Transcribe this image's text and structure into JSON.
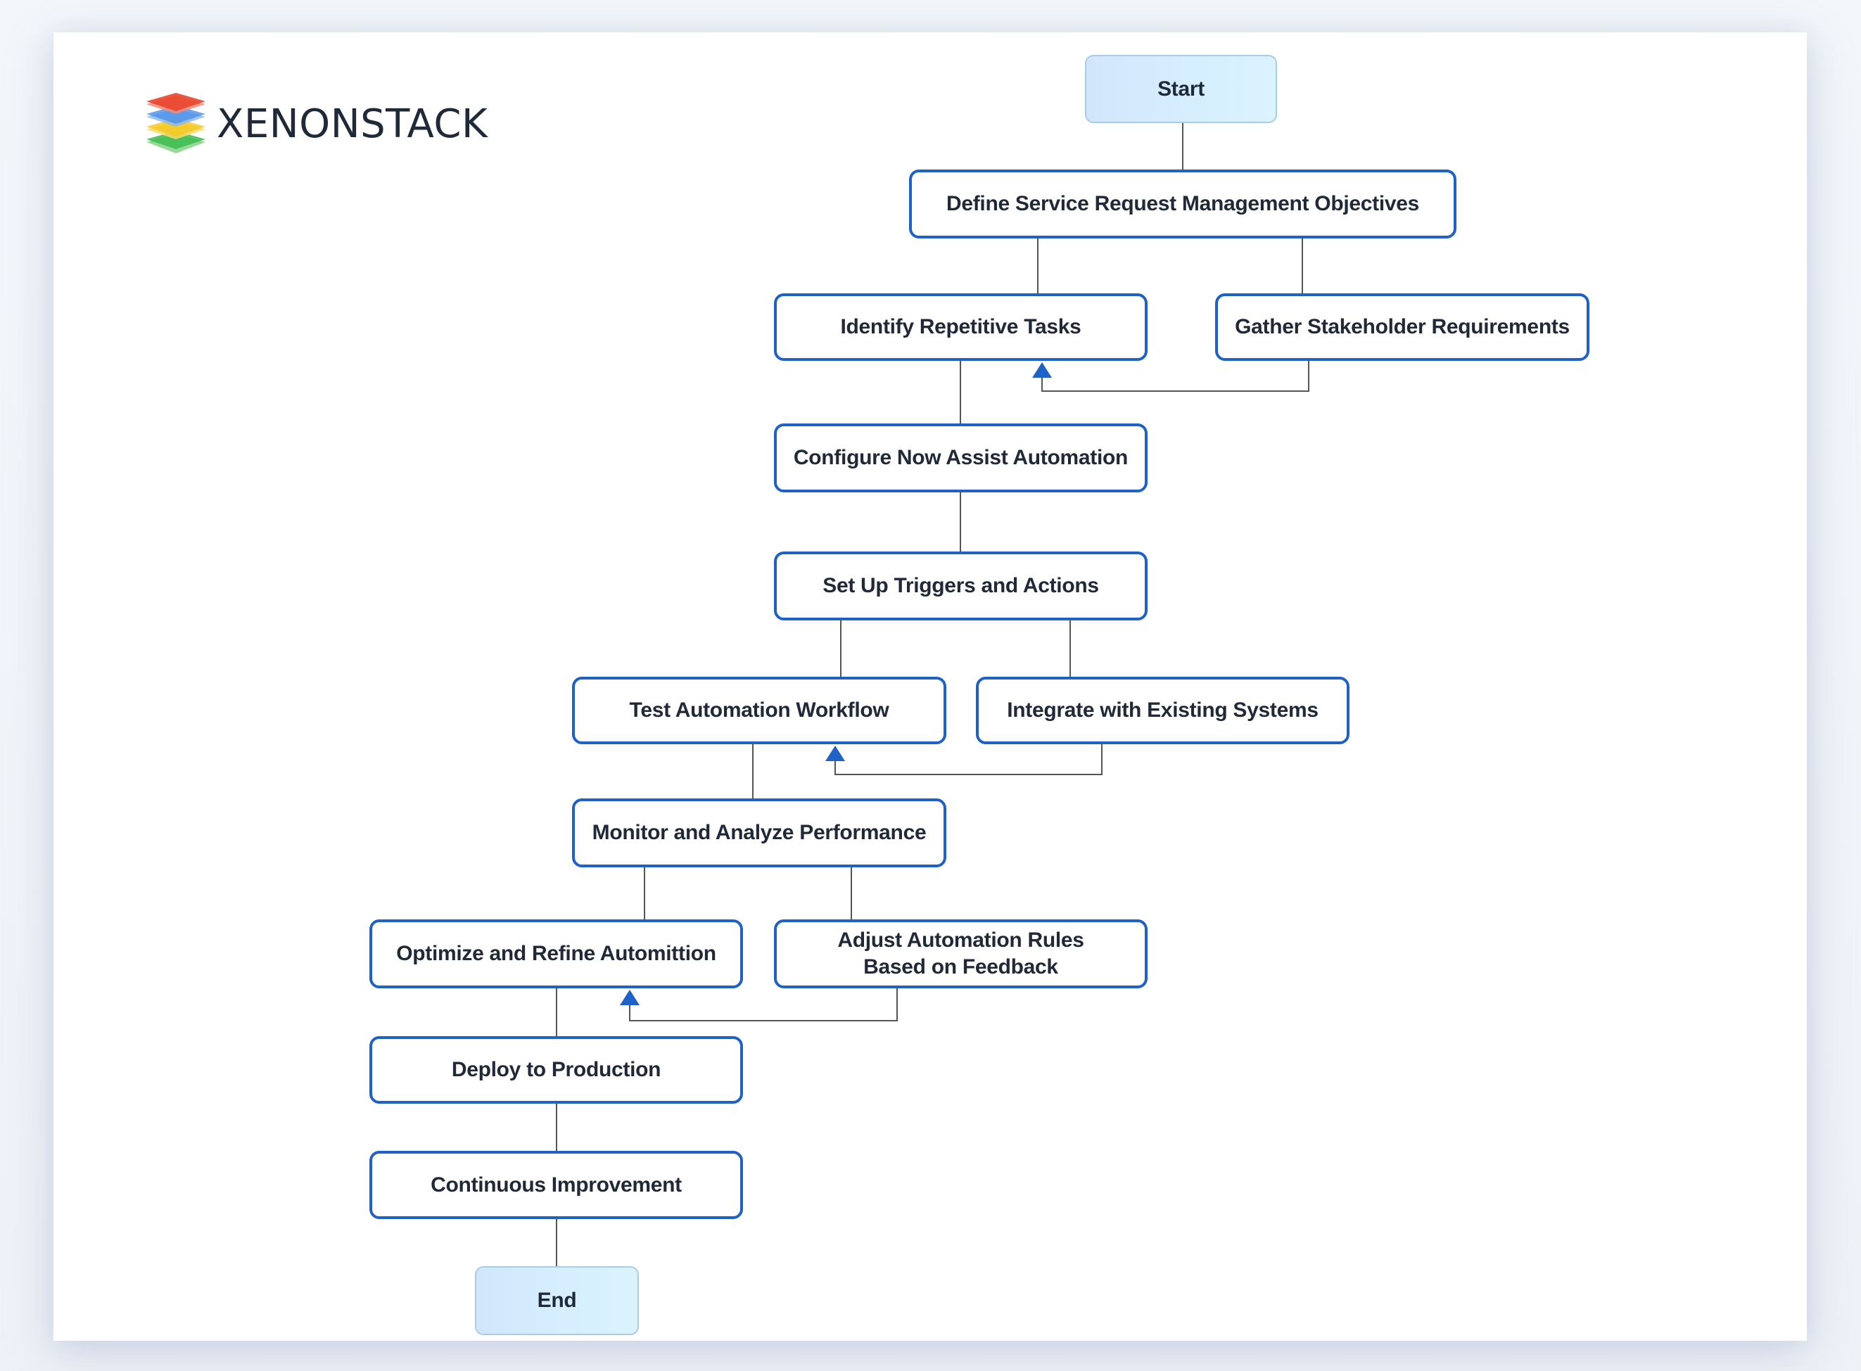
{
  "brand": {
    "name": "XENONSTACK",
    "logo_icon": "stacked-layers-icon",
    "logo_layer_colors": [
      "#e8452c",
      "#4a8fe8",
      "#f5c518",
      "#3dbb4c"
    ]
  },
  "colors": {
    "node_border": "#1e62c8",
    "node_text": "#1f2937",
    "terminal_fill": "#d6ecfd",
    "terminal_border": "#a9cde8",
    "edge": "#555555",
    "arrowhead": "#1e62c8"
  },
  "flowchart": {
    "nodes": [
      {
        "id": "start",
        "label": "Start",
        "type": "terminal"
      },
      {
        "id": "define",
        "label": "Define Service Request Management Objectives",
        "type": "process"
      },
      {
        "id": "identify",
        "label": "Identify Repetitive Tasks",
        "type": "process"
      },
      {
        "id": "gather",
        "label": "Gather Stakeholder Requirements",
        "type": "process"
      },
      {
        "id": "configure",
        "label": "Configure Now Assist Automation",
        "type": "process"
      },
      {
        "id": "setup",
        "label": "Set Up Triggers and Actions",
        "type": "process"
      },
      {
        "id": "test",
        "label": "Test Automation Workflow",
        "type": "process"
      },
      {
        "id": "integrate",
        "label": "Integrate with Existing Systems",
        "type": "process"
      },
      {
        "id": "monitor",
        "label": "Monitor and Analyze Performance",
        "type": "process"
      },
      {
        "id": "optimize",
        "label": "Optimize and Refine Automittion",
        "type": "process"
      },
      {
        "id": "adjust",
        "label": "Adjust Automation Rules\nBased on Feedback",
        "type": "process"
      },
      {
        "id": "deploy",
        "label": "Deploy to Production",
        "type": "process"
      },
      {
        "id": "continuous",
        "label": "Continuous Improvement",
        "type": "process"
      },
      {
        "id": "end",
        "label": "End",
        "type": "terminal"
      }
    ],
    "edges": [
      {
        "from": "start",
        "to": "define",
        "arrow": false
      },
      {
        "from": "define",
        "to": "identify",
        "arrow": false
      },
      {
        "from": "define",
        "to": "gather",
        "arrow": false
      },
      {
        "from": "gather",
        "to": "identify",
        "arrow": true
      },
      {
        "from": "identify",
        "to": "configure",
        "arrow": false
      },
      {
        "from": "configure",
        "to": "setup",
        "arrow": false
      },
      {
        "from": "setup",
        "to": "test",
        "arrow": false
      },
      {
        "from": "setup",
        "to": "integrate",
        "arrow": false
      },
      {
        "from": "integrate",
        "to": "test",
        "arrow": true
      },
      {
        "from": "test",
        "to": "monitor",
        "arrow": false
      },
      {
        "from": "monitor",
        "to": "optimize",
        "arrow": false
      },
      {
        "from": "monitor",
        "to": "adjust",
        "arrow": false
      },
      {
        "from": "adjust",
        "to": "optimize",
        "arrow": true
      },
      {
        "from": "optimize",
        "to": "deploy",
        "arrow": false
      },
      {
        "from": "deploy",
        "to": "continuous",
        "arrow": false
      },
      {
        "from": "continuous",
        "to": "end",
        "arrow": false
      }
    ]
  }
}
